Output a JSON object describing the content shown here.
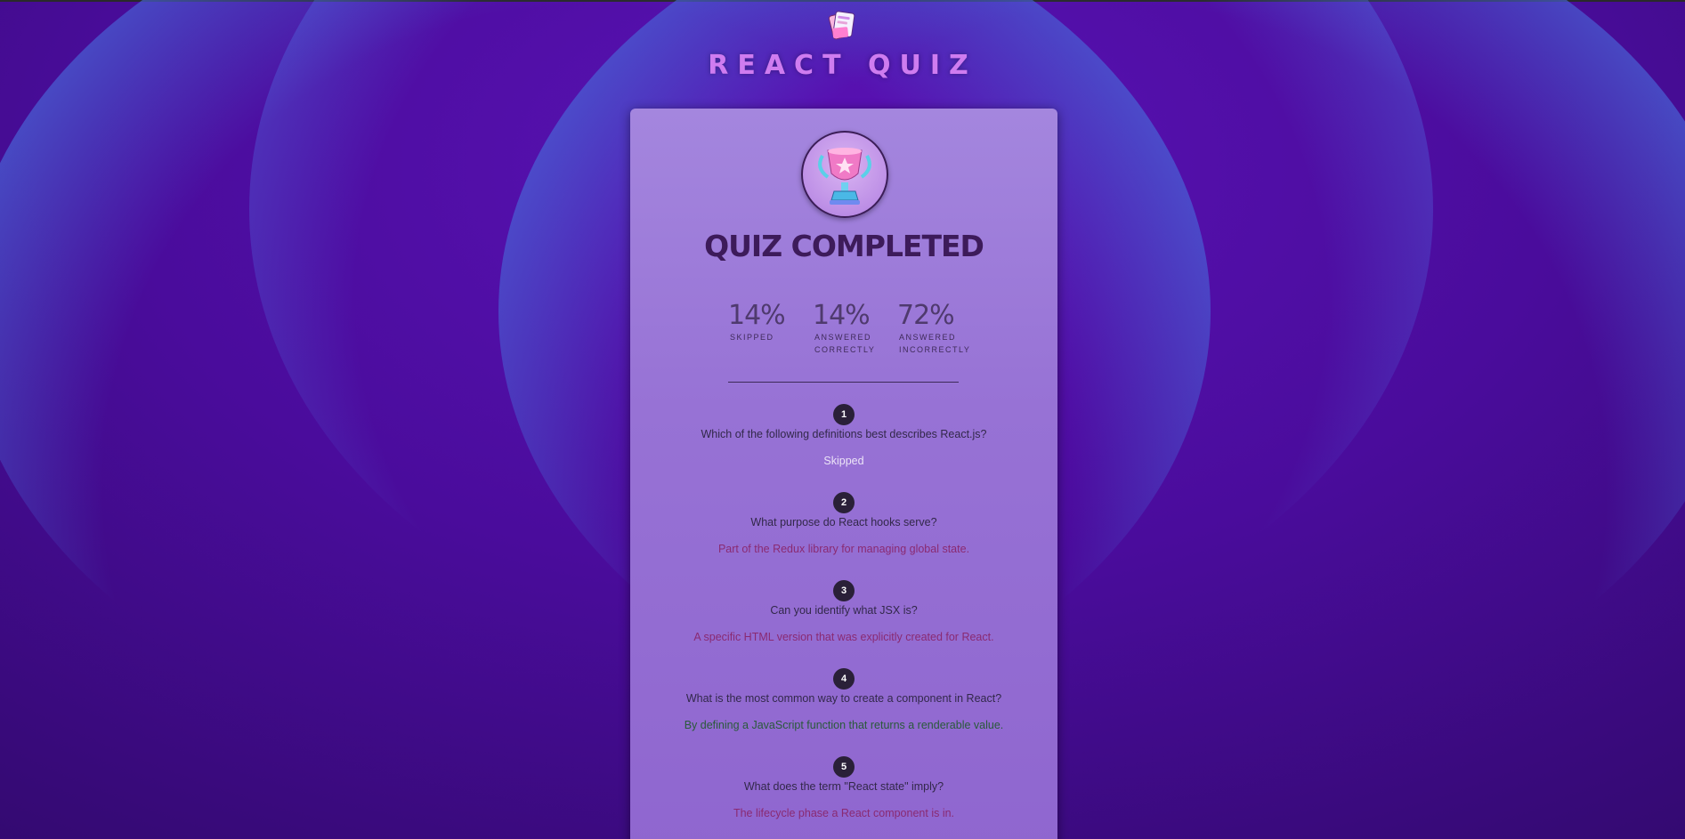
{
  "header": {
    "title": "REACT QUIZ",
    "logo_icon": "quiz-cards-logo-icon"
  },
  "summary": {
    "heading": "QUIZ COMPLETED",
    "trophy_icon": "trophy-icon",
    "stats": [
      {
        "value": "14%",
        "label": "Skipped"
      },
      {
        "value": "14%",
        "label": "Answered correctly"
      },
      {
        "value": "72%",
        "label": "Answered incorrectly"
      }
    ]
  },
  "results": [
    {
      "number": "1",
      "question": "Which of the following definitions best describes React.js?",
      "answer": "Skipped",
      "status": "skipped"
    },
    {
      "number": "2",
      "question": "What purpose do React hooks serve?",
      "answer": "Part of the Redux library for managing global state.",
      "status": "wrong"
    },
    {
      "number": "3",
      "question": "Can you identify what JSX is?",
      "answer": "A specific HTML version that was explicitly created for React.",
      "status": "wrong"
    },
    {
      "number": "4",
      "question": "What is the most common way to create a component in React?",
      "answer": "By defining a JavaScript function that returns a renderable value.",
      "status": "correct"
    },
    {
      "number": "5",
      "question": "What does the term \"React state\" imply?",
      "answer": "The lifecycle phase a React component is in.",
      "status": "wrong"
    }
  ],
  "colors": {
    "background": "#4a0c9c",
    "title": "#cf7cf0",
    "card": "#9772d5",
    "correct": "#2a5a3a",
    "wrong": "#8a2a72",
    "skipped": "#ece4f7"
  }
}
